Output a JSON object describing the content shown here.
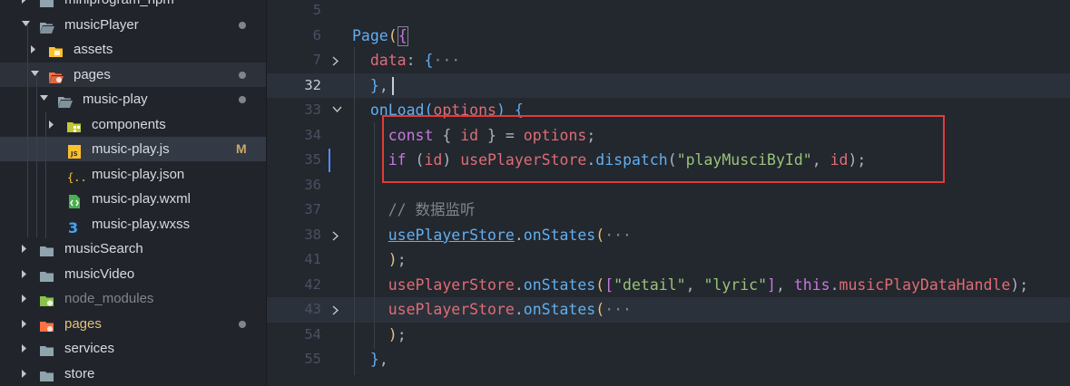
{
  "explorer": {
    "items": [
      {
        "label": "miniprogram_npm",
        "depth": 1,
        "type": "folder",
        "expanded": false,
        "icon": "folder-icon"
      },
      {
        "label": "musicPlayer",
        "depth": 1,
        "type": "folder",
        "expanded": true,
        "icon": "folder-icon",
        "dot": true
      },
      {
        "label": "assets",
        "depth": 2,
        "type": "folder",
        "expanded": false,
        "icon": "assets-folder-icon"
      },
      {
        "label": "pages",
        "depth": 2,
        "type": "folder",
        "expanded": true,
        "icon": "pages-folder-icon",
        "dot": true
      },
      {
        "label": "music-play",
        "depth": 3,
        "type": "folder",
        "expanded": true,
        "icon": "folder-icon",
        "dot": true
      },
      {
        "label": "components",
        "depth": 4,
        "type": "folder",
        "expanded": false,
        "icon": "components-folder-icon"
      },
      {
        "label": "music-play.js",
        "depth": 4,
        "type": "file",
        "icon": "js-file-icon",
        "badge": "M",
        "selected": true
      },
      {
        "label": "music-play.json",
        "depth": 4,
        "type": "file",
        "icon": "json-file-icon"
      },
      {
        "label": "music-play.wxml",
        "depth": 4,
        "type": "file",
        "icon": "wxml-file-icon"
      },
      {
        "label": "music-play.wxss",
        "depth": 4,
        "type": "file",
        "icon": "css-file-icon"
      },
      {
        "label": "musicSearch",
        "depth": 1,
        "type": "folder",
        "expanded": false,
        "icon": "folder-icon"
      },
      {
        "label": "musicVideo",
        "depth": 1,
        "type": "folder",
        "expanded": false,
        "icon": "folder-icon"
      },
      {
        "label": "node_modules",
        "depth": 1,
        "type": "folder",
        "expanded": false,
        "icon": "node-modules-folder-icon",
        "dim": true
      },
      {
        "label": "pages",
        "depth": 1,
        "type": "folder",
        "expanded": false,
        "icon": "pages-folder-icon",
        "dot": true,
        "orange": true
      },
      {
        "label": "services",
        "depth": 1,
        "type": "folder",
        "expanded": false,
        "icon": "folder-icon"
      },
      {
        "label": "store",
        "depth": 1,
        "type": "folder",
        "expanded": false,
        "icon": "folder-icon"
      }
    ]
  },
  "editor": {
    "lines": [
      {
        "num": "5",
        "tokens": []
      },
      {
        "num": "6",
        "tokens": [
          [
            "fn",
            "Page"
          ],
          [
            "brk1",
            "("
          ],
          [
            "brk2",
            "{"
          ]
        ]
      },
      {
        "num": "7",
        "fold": true,
        "tokens": [
          [
            "pl",
            "  "
          ],
          [
            "var",
            "data"
          ],
          [
            "pl",
            ": "
          ],
          [
            "brk3",
            "{"
          ],
          [
            "ell",
            "···"
          ]
        ]
      },
      {
        "num": "32",
        "current": true,
        "highlight": true,
        "tokens": [
          [
            "pl",
            "  "
          ],
          [
            "brk3",
            "}"
          ],
          [
            "pl",
            ","
          ]
        ]
      },
      {
        "num": "33",
        "foldOpen": true,
        "tokens": [
          [
            "pl",
            "  "
          ],
          [
            "fn",
            "onLoad"
          ],
          [
            "brk3",
            "("
          ],
          [
            "var",
            "options"
          ],
          [
            "brk3",
            ")"
          ],
          [
            "pl",
            " "
          ],
          [
            "brk3",
            "{"
          ]
        ]
      },
      {
        "num": "34",
        "tokens": [
          [
            "pl",
            "    "
          ],
          [
            "kw",
            "const"
          ],
          [
            "pl",
            " { "
          ],
          [
            "var",
            "id"
          ],
          [
            "pl",
            " } = "
          ],
          [
            "var",
            "options"
          ],
          [
            "pl",
            ";"
          ]
        ]
      },
      {
        "num": "35",
        "tokens": [
          [
            "pl",
            "    "
          ],
          [
            "kw",
            "if"
          ],
          [
            "pl",
            " ("
          ],
          [
            "var",
            "id"
          ],
          [
            "pl",
            ") "
          ],
          [
            "var",
            "usePlayerStore"
          ],
          [
            "pl",
            "."
          ],
          [
            "fn",
            "dispatch"
          ],
          [
            "pl",
            "("
          ],
          [
            "str",
            "\"playMusciById\""
          ],
          [
            "pl",
            ", "
          ],
          [
            "var",
            "id"
          ],
          [
            "pl",
            ");"
          ]
        ]
      },
      {
        "num": "36",
        "tokens": []
      },
      {
        "num": "37",
        "tokens": [
          [
            "pl",
            "    "
          ],
          [
            "cm",
            "// 数据监听"
          ]
        ]
      },
      {
        "num": "38",
        "fold": true,
        "tokens": [
          [
            "pl",
            "    "
          ],
          [
            "fn ul",
            "usePlayerStore"
          ],
          [
            "pl",
            "."
          ],
          [
            "fn",
            "onStates"
          ],
          [
            "brk1",
            "("
          ],
          [
            "ell",
            "···"
          ]
        ]
      },
      {
        "num": "41",
        "tokens": [
          [
            "pl",
            "    "
          ],
          [
            "brk1",
            ")"
          ],
          [
            "pl",
            ";"
          ]
        ]
      },
      {
        "num": "42",
        "tokens": [
          [
            "pl",
            "    "
          ],
          [
            "var",
            "usePlayerStore"
          ],
          [
            "pl",
            "."
          ],
          [
            "fn",
            "onStates"
          ],
          [
            "brk1",
            "("
          ],
          [
            "brk2",
            "["
          ],
          [
            "str",
            "\"detail\""
          ],
          [
            "pl",
            ", "
          ],
          [
            "str",
            "\"lyric\""
          ],
          [
            "brk2",
            "]"
          ],
          [
            "pl",
            ", "
          ],
          [
            "kw",
            "this"
          ],
          [
            "pl",
            "."
          ],
          [
            "var",
            "musicPlayDataHandle"
          ],
          [
            "pl",
            ");"
          ]
        ]
      },
      {
        "num": "43",
        "fold": true,
        "highlight": true,
        "tokens": [
          [
            "pl",
            "    "
          ],
          [
            "var",
            "usePlayerStore"
          ],
          [
            "pl",
            "."
          ],
          [
            "fn",
            "onStates"
          ],
          [
            "brk1",
            "("
          ],
          [
            "ell",
            "···"
          ]
        ]
      },
      {
        "num": "54",
        "tokens": [
          [
            "pl",
            "    "
          ],
          [
            "brk1",
            ")"
          ],
          [
            "pl",
            ";"
          ]
        ]
      },
      {
        "num": "55",
        "tokens": [
          [
            "pl",
            "  "
          ],
          [
            "brk3",
            "}"
          ],
          [
            "pl",
            ","
          ]
        ]
      }
    ]
  },
  "colors": {
    "accent": "#528bff",
    "highlight_box": "#e23b3b"
  }
}
